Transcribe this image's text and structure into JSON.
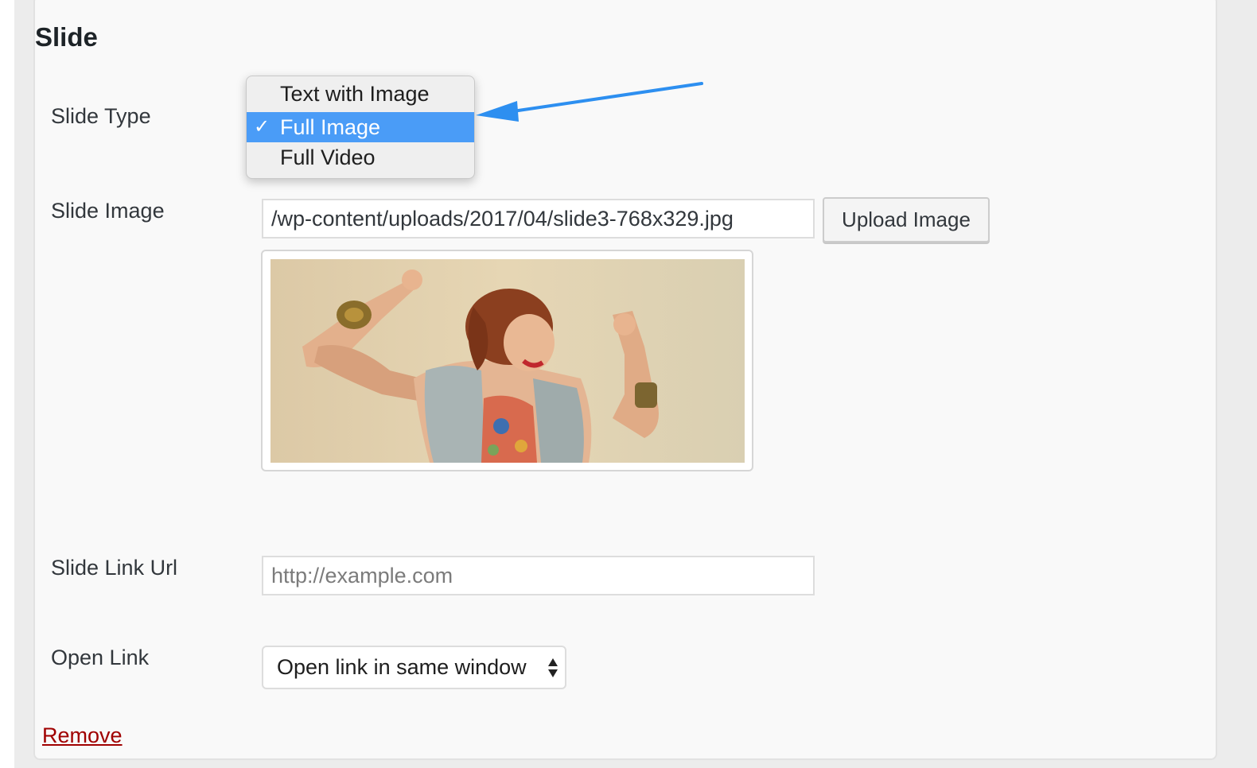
{
  "panel": {
    "title": "Slide"
  },
  "slide_type": {
    "label": "Slide Type",
    "options": [
      "Text with Image",
      "Full Image",
      "Full Video"
    ],
    "selected": "Full Image"
  },
  "slide_image": {
    "label": "Slide Image",
    "value": "/wp-content/uploads/2017/04/slide3-768x329.jpg",
    "upload_label": "Upload Image",
    "preview": "woman dancing with raised fists, denim vest, gold bracelets"
  },
  "slide_link": {
    "label": "Slide Link Url",
    "placeholder": "http://example.com"
  },
  "open_link": {
    "label": "Open Link",
    "selected": "Open link in same window"
  },
  "remove_label": "Remove",
  "colors": {
    "selected_option": "#4a9cf7",
    "annotation_arrow": "#2d8ff0",
    "remove_link": "#a00000"
  }
}
